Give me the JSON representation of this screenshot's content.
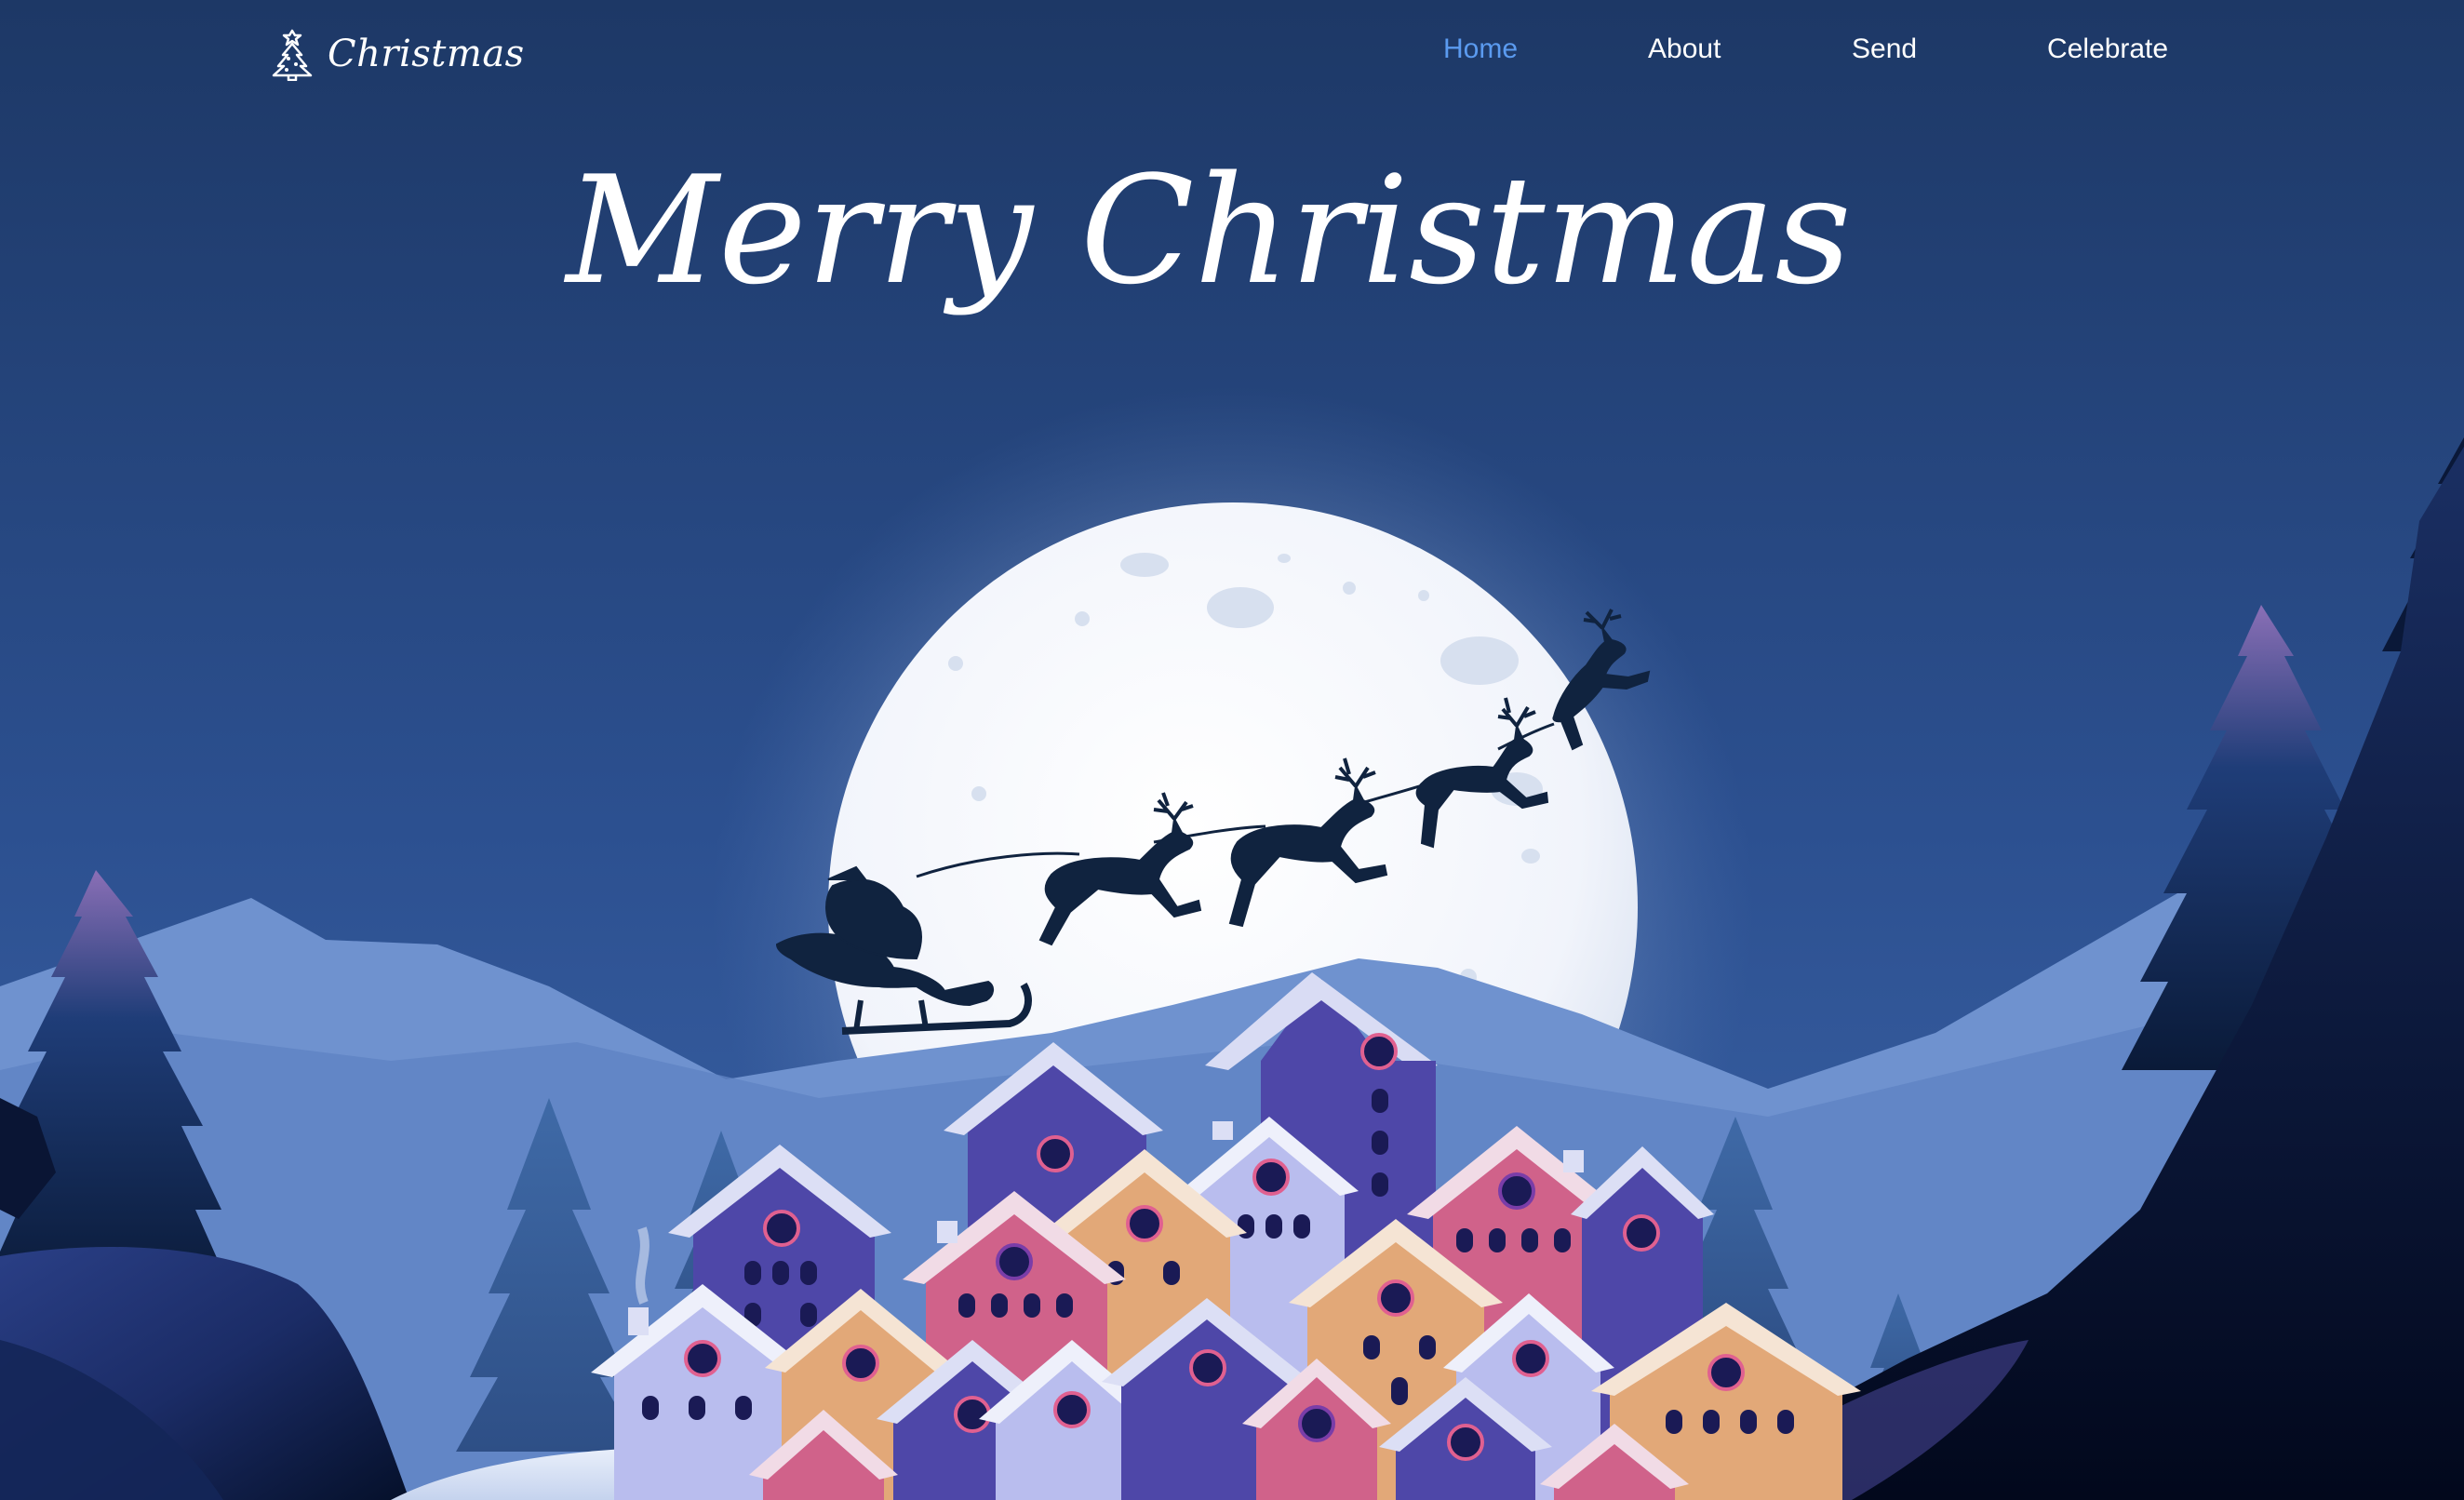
{
  "nav": {
    "brand_label": "Christmas",
    "brand_icon": "christmas-tree-icon",
    "links": [
      {
        "label": "Home",
        "active": true
      },
      {
        "label": "About",
        "active": false
      },
      {
        "label": "Send",
        "active": false
      },
      {
        "label": "Celebrate",
        "active": false
      }
    ]
  },
  "hero": {
    "title": "Merry Christmas"
  },
  "colors": {
    "sky_top": "#1e3a68",
    "sky_bottom": "#3d64a8",
    "active_link": "#5b9bf0",
    "moon": "#f4f7fc",
    "silhouette": "#10233f"
  }
}
